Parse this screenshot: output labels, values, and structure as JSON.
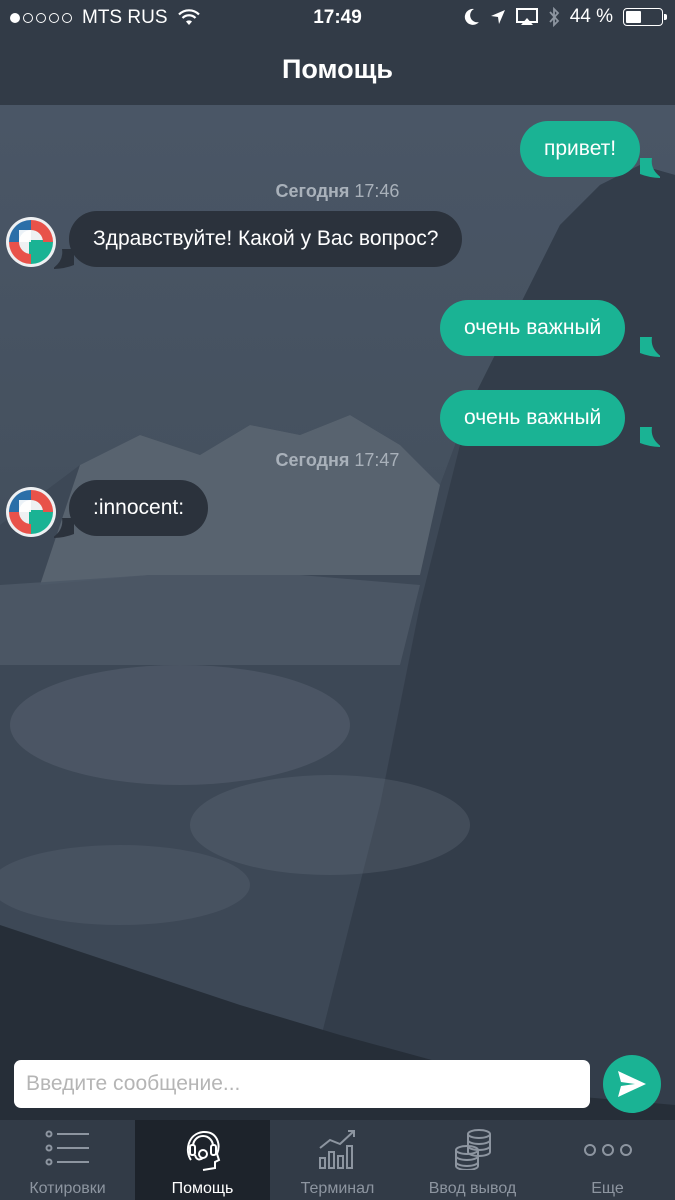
{
  "status_bar": {
    "carrier": "MTS RUS",
    "time": "17:49",
    "battery_text": "44 %",
    "battery_level": 0.44
  },
  "nav": {
    "title": "Помощь"
  },
  "chat": {
    "messages": [
      {
        "direction": "outgoing",
        "text": "привет!"
      },
      {
        "type": "timestamp",
        "day": "Сегодня",
        "time": "17:46"
      },
      {
        "direction": "incoming",
        "text": "Здравствуйте! Какой у Вас вопрос?"
      },
      {
        "direction": "outgoing",
        "text": "очень важный"
      },
      {
        "direction": "outgoing",
        "text": "очень важный"
      },
      {
        "type": "timestamp",
        "day": "Сегодня",
        "time": "17:47"
      },
      {
        "direction": "incoming",
        "text": ":innocent:"
      }
    ]
  },
  "composer": {
    "placeholder": "Введите сообщение...",
    "send_icon": "send-arrow-icon"
  },
  "tabs": [
    {
      "label": "Котировки",
      "icon": "list-icon",
      "active": false
    },
    {
      "label": "Помощь",
      "icon": "support-headset-icon",
      "active": true
    },
    {
      "label": "Терминал",
      "icon": "chart-icon",
      "active": false
    },
    {
      "label": "Ввод вывод",
      "icon": "coins-icon",
      "active": false
    },
    {
      "label": "Еще",
      "icon": "more-icon",
      "active": false
    }
  ],
  "colors": {
    "accent": "#1ab394",
    "bar_background": "#323b47",
    "incoming_bubble": "#2b323c",
    "active_tab": "#1d232b"
  }
}
